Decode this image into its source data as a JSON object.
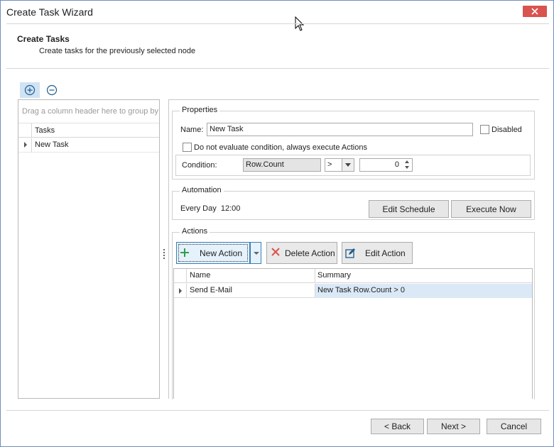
{
  "window": {
    "title": "Create Task Wizard"
  },
  "header": {
    "title": "Create Tasks",
    "subtitle": "Create tasks for the previously selected node"
  },
  "toolbar": {
    "add_icon": "plus-circle-icon",
    "remove_icon": "minus-circle-icon"
  },
  "tasks_grid": {
    "group_hint": "Drag a column header here to group by",
    "column": "Tasks",
    "rows": [
      "New Task"
    ]
  },
  "properties": {
    "legend": "Properties",
    "name_label": "Name:",
    "name_value": "New Task",
    "disabled_label": "Disabled",
    "no_eval_label": "Do not evaluate condition, always execute Actions",
    "condition_label": "Condition:",
    "condition_field": "Row.Count",
    "condition_operator": ">",
    "condition_value": "0"
  },
  "automation": {
    "legend": "Automation",
    "schedule": "Every Day  12:00",
    "edit_schedule": "Edit Schedule",
    "execute_now": "Execute Now"
  },
  "actions": {
    "legend": "Actions",
    "new_action": "New Action",
    "delete_action": "Delete Action",
    "edit_action": "Edit Action",
    "columns": {
      "name": "Name",
      "summary": "Summary"
    },
    "rows": [
      {
        "name": "Send E-Mail",
        "summary": "New Task Row.Count > 0"
      }
    ]
  },
  "footer": {
    "back": "< Back",
    "next": "Next >",
    "cancel": "Cancel"
  },
  "colors": {
    "accent": "#3c7fb1",
    "close": "#d9534f",
    "plus": "#2e9e4e",
    "delete": "#d9534f"
  }
}
